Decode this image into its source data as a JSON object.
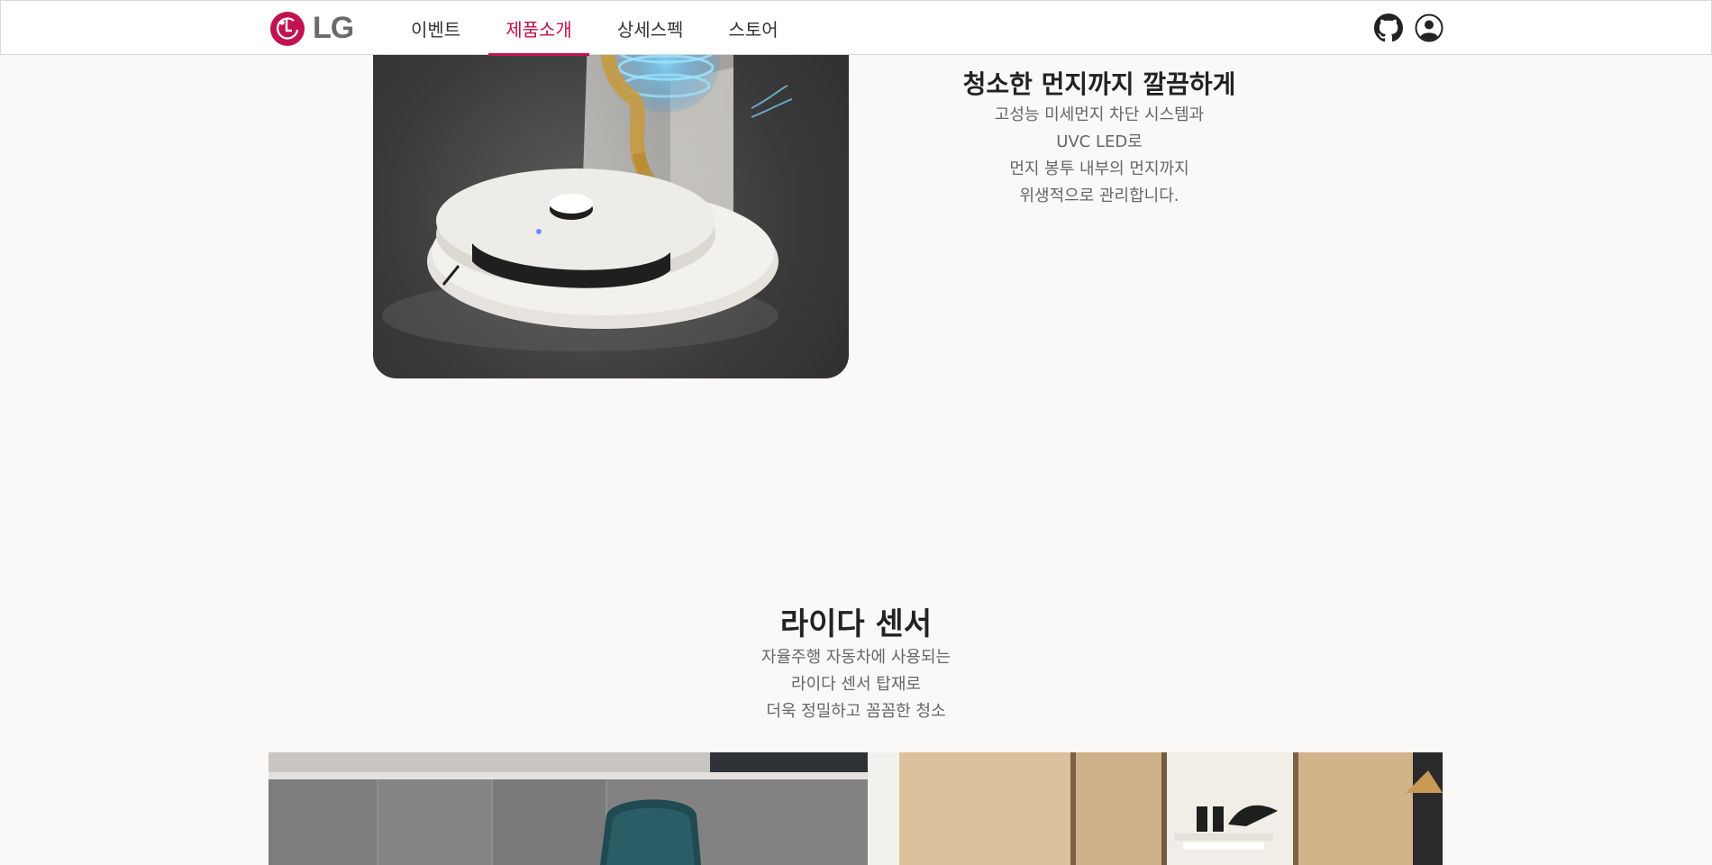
{
  "header": {
    "logo_text": "LG",
    "nav": [
      {
        "label": "이벤트",
        "active": false
      },
      {
        "label": "제품소개",
        "active": true
      },
      {
        "label": "상세스펙",
        "active": false
      },
      {
        "label": "스토어",
        "active": false
      }
    ],
    "icons": [
      "lg-logo-icon",
      "github-icon",
      "user-icon"
    ],
    "accent_color": "#c0134f"
  },
  "feature": {
    "title": "청소한 먼지까지 깔끔하게",
    "desc_lines": [
      "고성능 미세먼지 차단 시스템과",
      "UVC LED로",
      "먼지 봉투 내부의 먼지까지",
      "위생적으로 관리합니다."
    ]
  },
  "lidar": {
    "title": "라이다 센서",
    "desc_lines": [
      "자율주행 자동차에 사용되는",
      "라이다 센서 탑재로",
      "더욱 정밀하고 꼼꼼한 청소"
    ]
  }
}
